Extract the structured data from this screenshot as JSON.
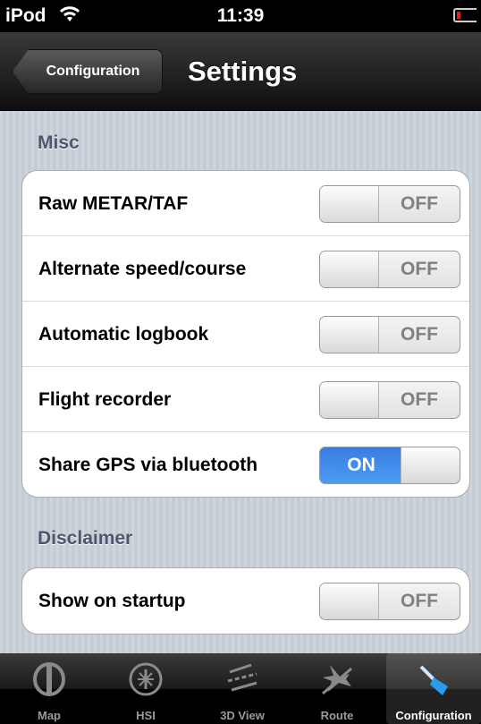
{
  "status_bar": {
    "carrier": "iPod",
    "time": "11:39"
  },
  "nav": {
    "back_label": "Configuration",
    "title": "Settings"
  },
  "sections": {
    "misc": {
      "header": "Misc",
      "rows": [
        {
          "label": "Raw METAR/TAF",
          "state": "OFF"
        },
        {
          "label": "Alternate speed/course",
          "state": "OFF"
        },
        {
          "label": "Automatic logbook",
          "state": "OFF"
        },
        {
          "label": "Flight recorder",
          "state": "OFF"
        },
        {
          "label": "Share GPS via bluetooth",
          "state": "ON"
        }
      ]
    },
    "disclaimer": {
      "header": "Disclaimer",
      "rows": [
        {
          "label": "Show on startup",
          "state": "OFF"
        }
      ]
    }
  },
  "tabs": [
    {
      "label": "Map",
      "icon": "map-icon",
      "active": false
    },
    {
      "label": "HSI",
      "icon": "hsi-icon",
      "active": false
    },
    {
      "label": "3D View",
      "icon": "3d-view-icon",
      "active": false
    },
    {
      "label": "Route",
      "icon": "route-icon",
      "active": false
    },
    {
      "label": "Configuration",
      "icon": "configuration-icon",
      "active": true
    }
  ],
  "colors": {
    "switch_on": "#3a7ce0",
    "section_header": "#4c566c",
    "battery_low": "#e02020"
  }
}
